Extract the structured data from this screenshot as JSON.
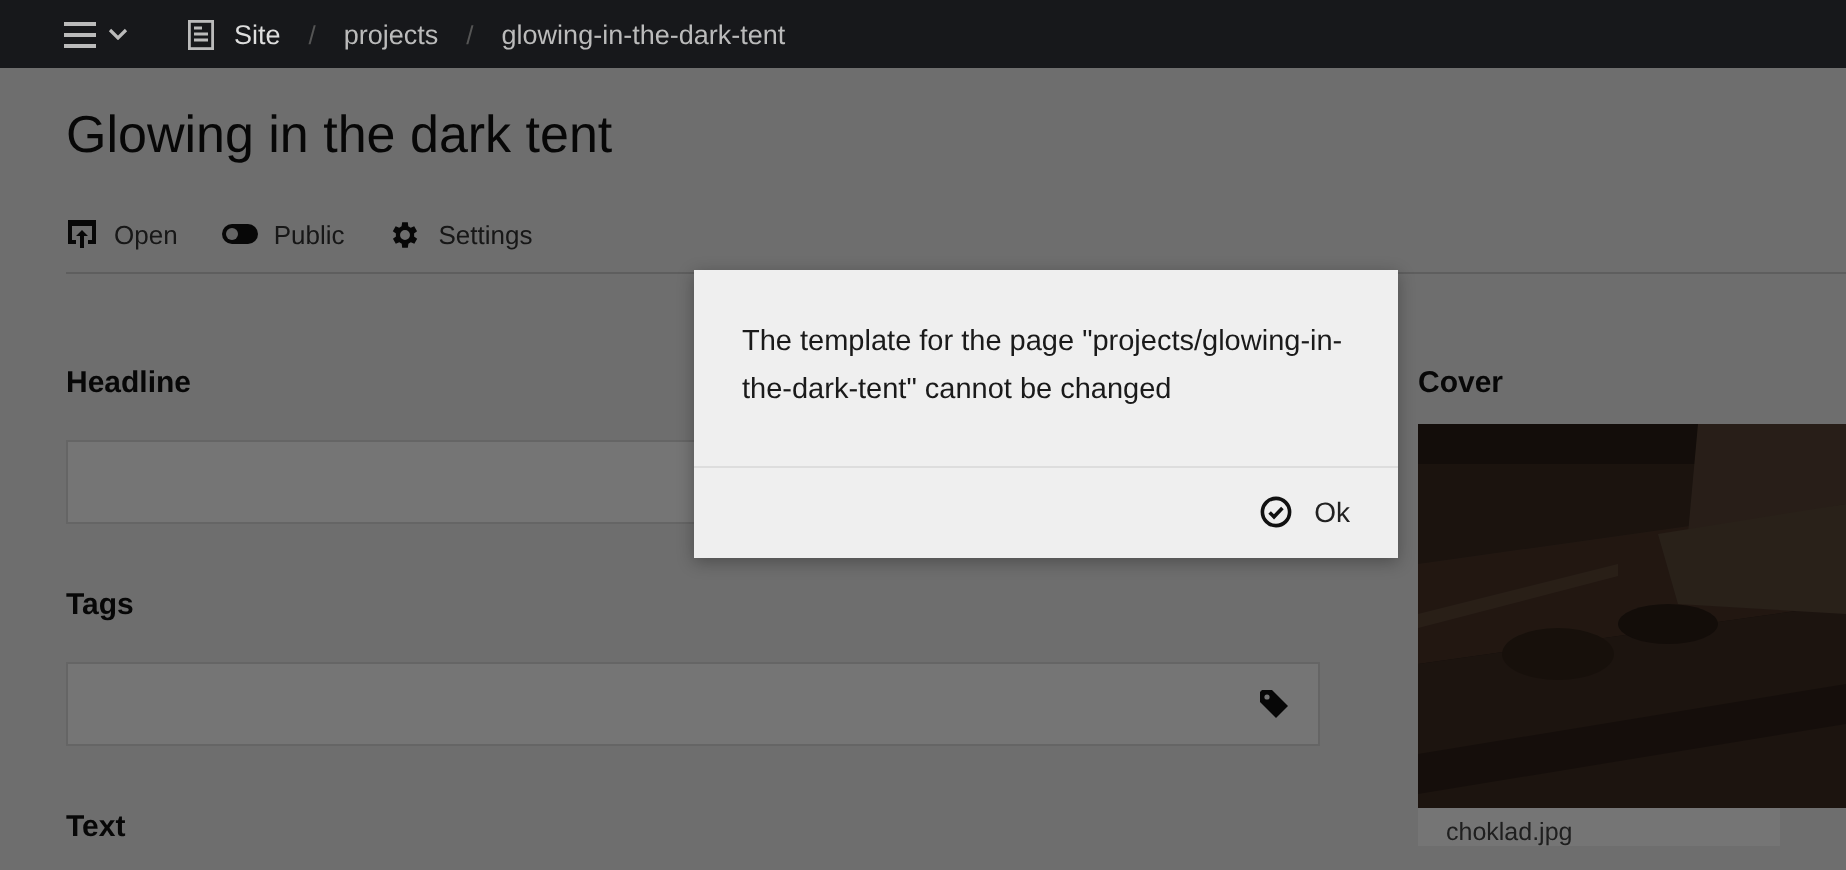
{
  "topbar": {
    "breadcrumbs": [
      {
        "label": "Site",
        "kind": "site"
      },
      {
        "label": "/",
        "kind": "separator"
      },
      {
        "label": "projects",
        "kind": "page"
      },
      {
        "label": "/",
        "kind": "separator"
      },
      {
        "label": "glowing-in-the-dark-tent",
        "kind": "page"
      }
    ]
  },
  "page": {
    "title": "Glowing in the dark tent",
    "actions": [
      {
        "label": "Open",
        "kind": "open"
      },
      {
        "label": "Public",
        "kind": "toggle"
      },
      {
        "label": "Settings",
        "kind": "settings"
      }
    ],
    "fields": [
      {
        "label": "Headline",
        "kind": "text"
      },
      {
        "label": "Tags",
        "kind": "tags"
      },
      {
        "label": "Text",
        "kind": "label"
      }
    ],
    "cover": {
      "label": "Cover",
      "filename": "choklad.jpg",
      "kind": "picture"
    }
  },
  "dialog": {
    "message": "The template for the page \"projects/glowing-in-the-dark-tent\" cannot be changed",
    "buttons": [
      "Ok"
    ]
  }
}
